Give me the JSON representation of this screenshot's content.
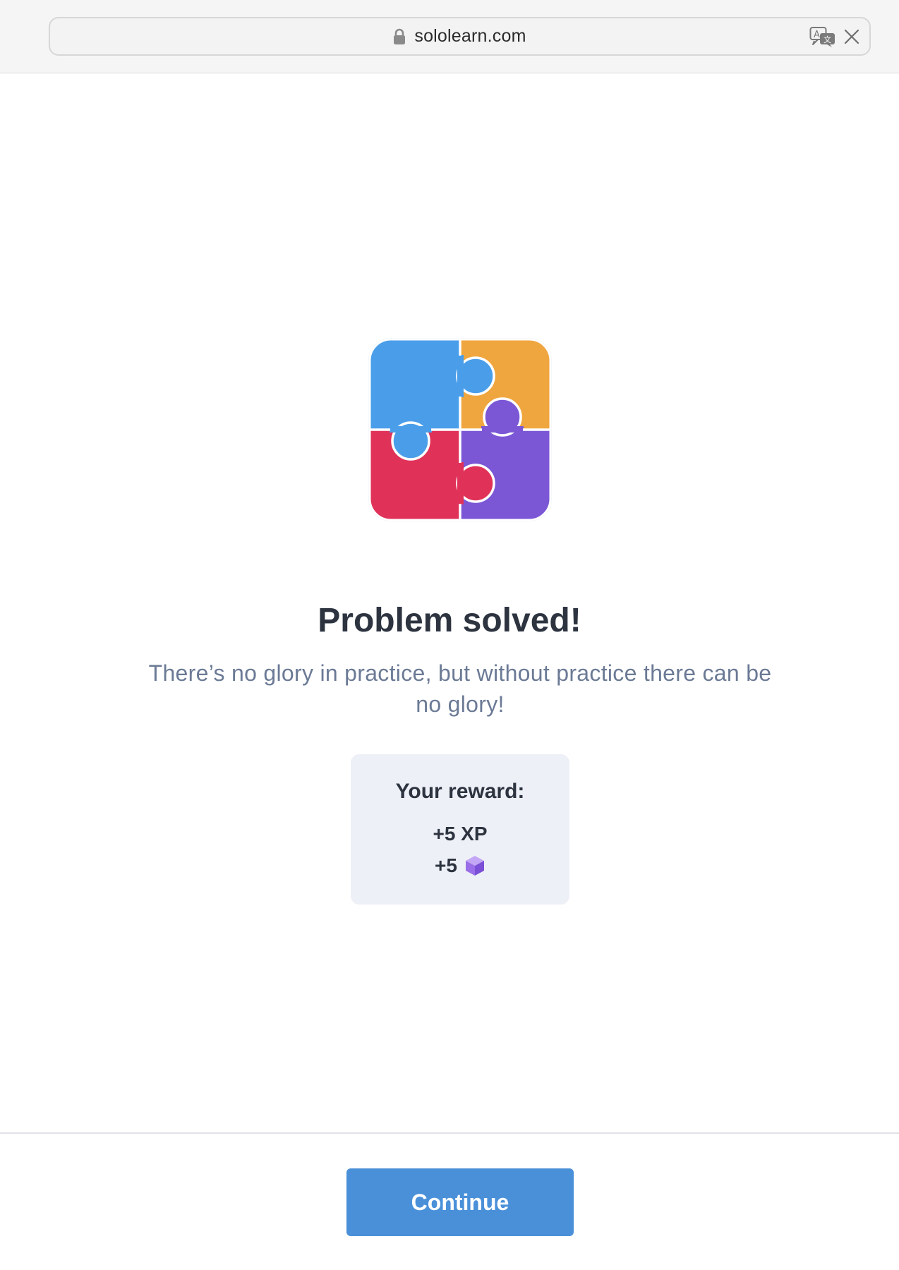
{
  "browser": {
    "url": "sololearn.com"
  },
  "result": {
    "title": "Problem solved!",
    "message": "There’s no glory in practice, but without practice there can be no glory!"
  },
  "reward": {
    "title": "Your reward:",
    "xp": "+5 XP",
    "gems": "+5"
  },
  "actions": {
    "continue_label": "Continue"
  },
  "colors": {
    "accent": "#4a90d9",
    "puzzle_blue": "#4a9ee9",
    "puzzle_orange": "#f0a63f",
    "puzzle_red": "#e03259",
    "puzzle_purple": "#7b57d6",
    "reward_card": "#eef0f7"
  },
  "icons": {
    "lock": "lock-icon",
    "translate": "translate-icon",
    "close": "close-icon",
    "gem": "gem-icon",
    "puzzle": "puzzle-icon"
  }
}
